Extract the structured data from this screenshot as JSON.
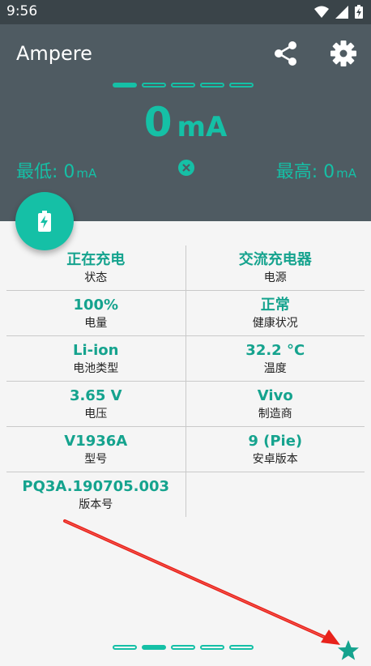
{
  "status_bar": {
    "time": "9:56"
  },
  "app": {
    "title": "Ampere"
  },
  "current": {
    "value": "0",
    "unit": "mA"
  },
  "min": {
    "label": "最低:",
    "value": "0",
    "unit": "mA"
  },
  "max": {
    "label": "最高:",
    "value": "0",
    "unit": "mA"
  },
  "pager": {
    "top_active_index": 0,
    "bottom_active_index": 1,
    "count": 5
  },
  "info": [
    [
      {
        "value": "正在充电",
        "label": "状态"
      },
      {
        "value": "交流充电器",
        "label": "电源"
      }
    ],
    [
      {
        "value": "100%",
        "label": "电量"
      },
      {
        "value": "正常",
        "label": "健康状况"
      }
    ],
    [
      {
        "value": "Li-ion",
        "label": "电池类型"
      },
      {
        "value": "32.2 °C",
        "label": "温度"
      }
    ],
    [
      {
        "value": "3.65 V",
        "label": "电压"
      },
      {
        "value": "Vivo",
        "label": "制造商"
      }
    ],
    [
      {
        "value": "V1936A",
        "label": "型号"
      },
      {
        "value": "9 (Pie)",
        "label": "安卓版本"
      }
    ],
    [
      {
        "value": "PQ3A.190705.003",
        "label": "版本号"
      },
      {
        "value": "",
        "label": ""
      }
    ]
  ],
  "colors": {
    "accent": "#15c0a6",
    "header": "#4f5b62",
    "statusbar": "#3a4449",
    "annotation_arrow": "#e8231c"
  }
}
